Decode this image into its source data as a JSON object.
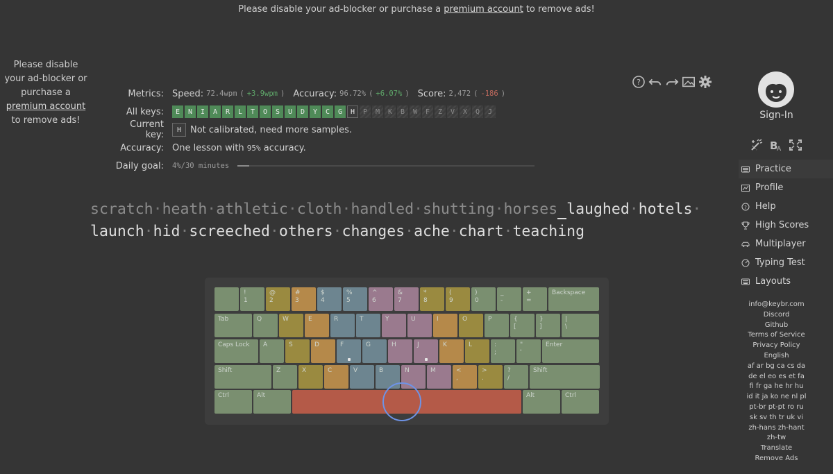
{
  "banner": {
    "prefix": "Please disable your ad-blocker or purchase a ",
    "link": "premium account",
    "suffix": " to remove ads!"
  },
  "left_ad": {
    "line1": "Please disable",
    "line2": "your ad-blocker or",
    "line3": "purchase a",
    "link": "premium account",
    "line5": "to remove ads!"
  },
  "metrics": {
    "metrics_label": "Metrics:",
    "speed_label": "Speed:",
    "speed_value": "72.4wpm",
    "speed_delta": "+3.9wpm",
    "accuracy_label": "Accuracy:",
    "accuracy_value": "96.72%",
    "accuracy_delta": "+6.07%",
    "score_label": "Score:",
    "score_value": "2,472",
    "score_delta": "-186",
    "all_keys_label": "All keys:",
    "current_key_label": "Current key:",
    "current_key": "H",
    "current_key_status": "Not calibrated, need more samples.",
    "accuracy2_label": "Accuracy:",
    "accuracy2_prefix": "One lesson with ",
    "accuracy2_value": "95%",
    "accuracy2_suffix": " accuracy.",
    "daily_goal_label": "Daily goal:",
    "daily_goal_value": "4%/30 minutes",
    "daily_goal_fraction": 0.04
  },
  "all_keys": [
    {
      "k": "E",
      "s": "done"
    },
    {
      "k": "N",
      "s": "done"
    },
    {
      "k": "I",
      "s": "done"
    },
    {
      "k": "A",
      "s": "done"
    },
    {
      "k": "R",
      "s": "done"
    },
    {
      "k": "L",
      "s": "done"
    },
    {
      "k": "T",
      "s": "done"
    },
    {
      "k": "O",
      "s": "done"
    },
    {
      "k": "S",
      "s": "done"
    },
    {
      "k": "U",
      "s": "done"
    },
    {
      "k": "D",
      "s": "done"
    },
    {
      "k": "Y",
      "s": "done"
    },
    {
      "k": "C",
      "s": "done"
    },
    {
      "k": "G",
      "s": "done"
    },
    {
      "k": "H",
      "s": "cur"
    },
    {
      "k": "P",
      "s": "todo"
    },
    {
      "k": "M",
      "s": "todo"
    },
    {
      "k": "K",
      "s": "todo"
    },
    {
      "k": "B",
      "s": "todo"
    },
    {
      "k": "W",
      "s": "todo"
    },
    {
      "k": "F",
      "s": "todo"
    },
    {
      "k": "Z",
      "s": "todo"
    },
    {
      "k": "V",
      "s": "todo"
    },
    {
      "k": "X",
      "s": "todo"
    },
    {
      "k": "Q",
      "s": "todo"
    },
    {
      "k": "J",
      "s": "todo"
    }
  ],
  "toolbar": {
    "icons": [
      "help-icon",
      "undo-icon",
      "redo-icon",
      "picture-icon",
      "gear-icon"
    ]
  },
  "practice_text": {
    "typed": [
      "scratch",
      "heath",
      "athletic",
      "cloth",
      "handled",
      "shutting",
      "horses"
    ],
    "untyped_line1": [
      "laughed",
      "hotels"
    ],
    "line2": [
      "launch",
      "hid",
      "screeched",
      "others",
      "changes",
      "ache",
      "chart",
      "teaching"
    ],
    "separator": "·"
  },
  "keyboard": {
    "rows": [
      [
        {
          "top": "",
          "bottom": "",
          "c": "kz"
        },
        {
          "top": "!",
          "bottom": "1",
          "c": "kz"
        },
        {
          "top": "@",
          "bottom": "2",
          "c": "ky"
        },
        {
          "top": "#",
          "bottom": "3",
          "c": "ko"
        },
        {
          "top": "$",
          "bottom": "4",
          "c": "kb"
        },
        {
          "top": "%",
          "bottom": "5",
          "c": "kb"
        },
        {
          "top": "^",
          "bottom": "6",
          "c": "kp"
        },
        {
          "top": "&",
          "bottom": "7",
          "c": "kp"
        },
        {
          "top": "*",
          "bottom": "8",
          "c": "ky"
        },
        {
          "top": "(",
          "bottom": "9",
          "c": "ky"
        },
        {
          "top": ")",
          "bottom": "0",
          "c": "kz"
        },
        {
          "top": "_",
          "bottom": "-",
          "c": "kz"
        },
        {
          "top": "+",
          "bottom": "=",
          "c": "kz"
        },
        {
          "top": "Backspace",
          "bottom": "",
          "c": "kz"
        }
      ],
      [
        {
          "top": "Tab",
          "bottom": "",
          "c": "kz"
        },
        {
          "top": "Q",
          "bottom": "",
          "c": "kz"
        },
        {
          "top": "W",
          "bottom": "",
          "c": "ky"
        },
        {
          "top": "E",
          "bottom": "",
          "c": "ko"
        },
        {
          "top": "R",
          "bottom": "",
          "c": "kb"
        },
        {
          "top": "T",
          "bottom": "",
          "c": "kb"
        },
        {
          "top": "Y",
          "bottom": "",
          "c": "kp"
        },
        {
          "top": "U",
          "bottom": "",
          "c": "kp"
        },
        {
          "top": "I",
          "bottom": "",
          "c": "ko"
        },
        {
          "top": "O",
          "bottom": "",
          "c": "ky"
        },
        {
          "top": "P",
          "bottom": "",
          "c": "kz"
        },
        {
          "top": "{",
          "bottom": "[",
          "c": "kz"
        },
        {
          "top": "}",
          "bottom": "]",
          "c": "kz"
        },
        {
          "top": "|",
          "bottom": "\\",
          "c": "kz"
        }
      ],
      [
        {
          "top": "Caps Lock",
          "bottom": "",
          "c": "kz"
        },
        {
          "top": "A",
          "bottom": "",
          "c": "kz"
        },
        {
          "top": "S",
          "bottom": "",
          "c": "ky"
        },
        {
          "top": "D",
          "bottom": "",
          "c": "ko"
        },
        {
          "top": "F",
          "bottom": "",
          "c": "kb",
          "home": true
        },
        {
          "top": "G",
          "bottom": "",
          "c": "kb"
        },
        {
          "top": "H",
          "bottom": "",
          "c": "kp"
        },
        {
          "top": "J",
          "bottom": "",
          "c": "kp",
          "home": true
        },
        {
          "top": "K",
          "bottom": "",
          "c": "ko"
        },
        {
          "top": "L",
          "bottom": "",
          "c": "ky"
        },
        {
          "top": ":",
          "bottom": ";",
          "c": "kz"
        },
        {
          "top": "\"",
          "bottom": "'",
          "c": "kz"
        },
        {
          "top": "Enter",
          "bottom": "",
          "c": "kz"
        }
      ],
      [
        {
          "top": "Shift",
          "bottom": "",
          "c": "kz"
        },
        {
          "top": "Z",
          "bottom": "",
          "c": "kz"
        },
        {
          "top": "X",
          "bottom": "",
          "c": "ky"
        },
        {
          "top": "C",
          "bottom": "",
          "c": "ko"
        },
        {
          "top": "V",
          "bottom": "",
          "c": "kb"
        },
        {
          "top": "B",
          "bottom": "",
          "c": "kb"
        },
        {
          "top": "N",
          "bottom": "",
          "c": "kp"
        },
        {
          "top": "M",
          "bottom": "",
          "c": "kp"
        },
        {
          "top": "<",
          "bottom": ",",
          "c": "ko"
        },
        {
          "top": ">",
          "bottom": ".",
          "c": "ky"
        },
        {
          "top": "?",
          "bottom": "/",
          "c": "kz"
        },
        {
          "top": "Shift",
          "bottom": "",
          "c": "kz"
        }
      ],
      [
        {
          "top": "Ctrl",
          "bottom": "",
          "c": "kz"
        },
        {
          "top": "Alt",
          "bottom": "",
          "c": "kz"
        },
        {
          "top": "",
          "bottom": "",
          "c": "kspace"
        },
        {
          "top": "Alt",
          "bottom": "",
          "c": "kz"
        },
        {
          "top": "Ctrl",
          "bottom": "",
          "c": "kz"
        }
      ]
    ]
  },
  "sidebar": {
    "signin": "Sign-In",
    "tools": [
      "magic-wand-icon",
      "font-size-icon",
      "fullscreen-icon"
    ],
    "nav": [
      {
        "label": "Practice",
        "icon": "keyboard-icon",
        "active": true
      },
      {
        "label": "Profile",
        "icon": "chart-icon",
        "active": false
      },
      {
        "label": "Help",
        "icon": "question-icon",
        "active": false
      },
      {
        "label": "High Scores",
        "icon": "trophy-icon",
        "active": false
      },
      {
        "label": "Multiplayer",
        "icon": "car-icon",
        "active": false
      },
      {
        "label": "Typing Test",
        "icon": "gauge-icon",
        "active": false
      },
      {
        "label": "Layouts",
        "icon": "keyboard-layout-icon",
        "active": false
      }
    ],
    "links": [
      "info@keybr.com",
      "Discord",
      "Github",
      "Terms of Service",
      "Privacy Policy",
      "English",
      "af ar bg ca cs da",
      "de el eo es et fa",
      "fi fr ga he hr hu",
      "id it ja ko ne nl pl",
      "pt-br pt-pt ro ru",
      "sk sv th tr uk vi",
      "zh-hans zh-hant",
      "zh-tw",
      "Translate",
      "Remove Ads"
    ]
  }
}
